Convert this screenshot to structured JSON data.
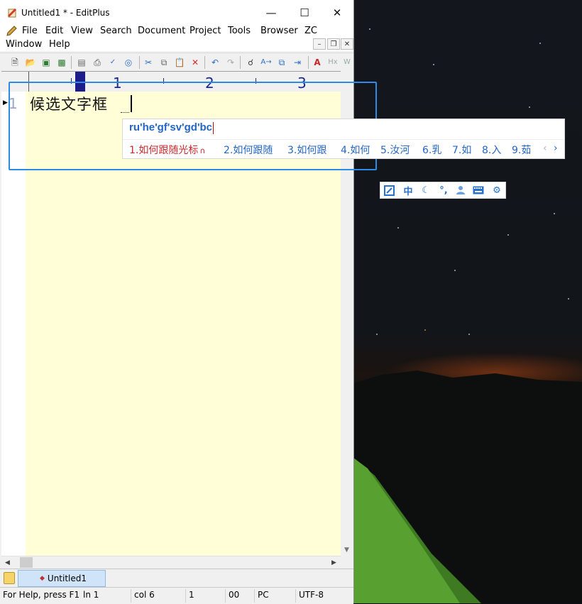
{
  "window": {
    "title": "Untitled1 * - EditPlus"
  },
  "menu": [
    "File",
    "Edit",
    "View",
    "Search",
    "Document",
    "Project",
    "Tools",
    "Browser",
    "ZC",
    "Window",
    "Help"
  ],
  "ruler": {
    "marks": [
      "1",
      "2",
      "3"
    ]
  },
  "editor": {
    "line_number": "1",
    "line_text": "候选文字框"
  },
  "ime": {
    "composition": "ru'he'gf'sv'gd'bc",
    "candidates": [
      "1.如何跟随光标",
      "2.如何跟随",
      "3.如何跟",
      "4.如何",
      "5.汝河",
      "6.乳",
      "7.如",
      "8.入",
      "9.茹"
    ],
    "page_prev": "‹",
    "page_next": "›",
    "status_icons": [
      "toolbox-icon",
      "chinese-mode",
      "moon-icon",
      "punctuation-icon",
      "user-icon",
      "keyboard-icon",
      "settings-icon"
    ],
    "status_mode_label": "中"
  },
  "tabs": [
    {
      "label": "Untitled1"
    }
  ],
  "status": {
    "help": "For Help, press F1",
    "ln": "ln 1",
    "col": "col 6",
    "field3": "1",
    "field4": "00",
    "format": "PC",
    "encoding": "UTF-8"
  },
  "colors": {
    "accent": "#2b8be6",
    "editor_bg": "#fffed6",
    "candidate": "#2466c4",
    "candidate_selected": "#c9282b"
  }
}
